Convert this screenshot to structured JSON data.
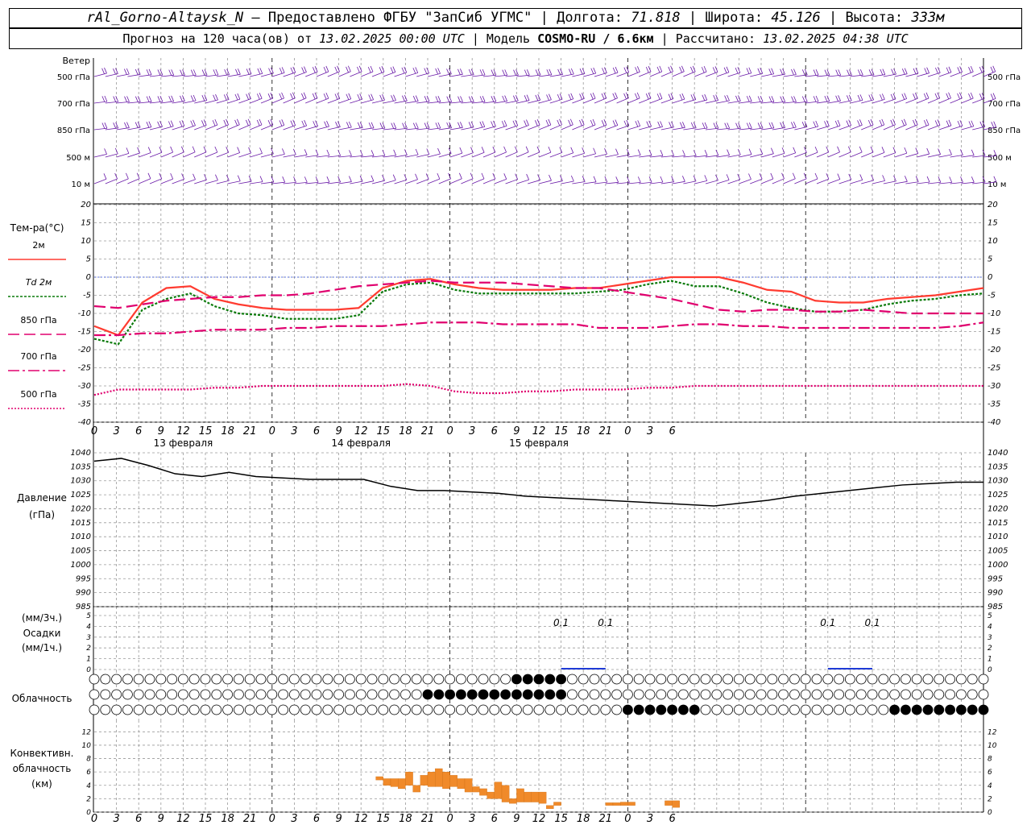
{
  "header": {
    "station": "rAl_Gorno-Altaysk_N",
    "dash": "—",
    "provider": "Предоставлено ФГБУ \"ЗапСиб УГМС\"",
    "lon_label": "Долгота:",
    "lon": "71.818",
    "lat_label": "Широта:",
    "lat": "45.126",
    "alt_label": "Высота:",
    "alt": "333м",
    "sep": "|",
    "forecast_label": "Прогноз на 120 часа(ов) от",
    "forecast_from": "13.02.2025 00:00 UTC",
    "model_label": "Модель",
    "model": "COSMO-RU / 6.6км",
    "calc_label": "Рассчитано:",
    "calc_time": "13.02.2025 04:38 UTC"
  },
  "colors": {
    "t2m": "#ff3b30",
    "td2m": "#0a7a0a",
    "t850": "#e0006e",
    "t700": "#e0006e",
    "t500": "#e0006e",
    "wind": "#6a1aa8",
    "pressure": "#000000",
    "precip": "#1f3bd6",
    "convective": "#f08a2a",
    "grid": "#9a9a9a"
  },
  "x_axis": {
    "ticks": [
      "0",
      "3",
      "6",
      "9",
      "12",
      "15",
      "18",
      "21",
      "0",
      "3",
      "6",
      "9",
      "12",
      "15",
      "18",
      "21",
      "0",
      "3",
      "6",
      "9",
      "12",
      "15",
      "18",
      "21",
      "0",
      "3",
      "6"
    ],
    "date_labels": [
      "13 февраля",
      "14 февраля",
      "15 февраля"
    ]
  },
  "wind_panel": {
    "title": "Ветер",
    "levels": [
      "500 гПа",
      "700 гПа",
      "850 гПа",
      "500 м",
      "10 м"
    ]
  },
  "temp_panel": {
    "title": "Тем-ра(°C)",
    "legend": [
      "2м",
      "Td  2м",
      "850 гПа",
      "700 гПа",
      "500 гПа"
    ],
    "yticks": [
      "20",
      "15",
      "10",
      "5",
      "0",
      "-5",
      "-10",
      "-15",
      "-20",
      "-25",
      "-30",
      "-35",
      "-40"
    ]
  },
  "pressure_panel": {
    "title": "Давление",
    "unit": "(гПа)",
    "yticks": [
      "1040",
      "1035",
      "1030",
      "1025",
      "1020",
      "1015",
      "1010",
      "1005",
      "1000",
      "995",
      "990",
      "985"
    ]
  },
  "precip_panel": {
    "unit3": "(мм/3ч.)",
    "title": "Осадки",
    "unit1": "(мм/1ч.)",
    "yticks": [
      "5",
      "4",
      "3",
      "2",
      "1",
      "0"
    ],
    "labels": [
      {
        "hour": 63,
        "text": "0.1"
      },
      {
        "hour": 69,
        "text": "0.1"
      },
      {
        "hour": 99,
        "text": "0.1"
      },
      {
        "hour": 105,
        "text": "0.1"
      }
    ]
  },
  "cloud_panel": {
    "title": "Облачность"
  },
  "conv_panel": {
    "title1": "Конвективн.",
    "title2": "облачность",
    "unit": "(км)",
    "yticks": [
      "12",
      "10",
      "8",
      "6",
      "4",
      "2",
      "0"
    ]
  },
  "chart_data": [
    {
      "type": "line",
      "title": "Тем-ра(°C)",
      "ylim": [
        -40,
        20
      ],
      "x_hours": [
        0,
        3,
        6,
        9,
        12,
        15,
        18,
        21,
        24,
        27,
        30,
        33,
        36,
        39,
        42,
        45,
        48,
        51,
        54,
        57,
        60,
        63,
        66,
        69,
        72,
        75,
        78,
        81,
        84,
        87,
        90,
        93,
        96,
        99,
        102,
        105,
        108,
        111,
        114,
        117,
        120
      ],
      "series": [
        {
          "name": "2м",
          "values": [
            -13.5,
            -16,
            -7,
            -3,
            -2.5,
            -6,
            -7.5,
            -8.5,
            -9,
            -9,
            -9,
            -8.5,
            -3,
            -1,
            -0.5,
            -2,
            -3,
            -3.5,
            -3.5,
            -3.5,
            -3,
            -3,
            -2,
            -1,
            0,
            0,
            0,
            -1.5,
            -3.5,
            -4,
            -6.5,
            -7,
            -7,
            -6,
            -5.5,
            -5,
            -4,
            -3
          ]
        },
        {
          "name": "Td  2м",
          "values": [
            -17,
            -18.5,
            -9,
            -6,
            -4.5,
            -8,
            -10,
            -10.5,
            -11.5,
            -11.5,
            -11.5,
            -10.5,
            -4,
            -2,
            -1.5,
            -3.5,
            -4.5,
            -4.5,
            -4.5,
            -4.5,
            -4.5,
            -4,
            -3.5,
            -2,
            -1,
            -2.5,
            -2.5,
            -4.5,
            -7,
            -8.5,
            -9.5,
            -9.5,
            -9,
            -7.5,
            -6.5,
            -6,
            -5,
            -4.5
          ]
        },
        {
          "name": "850 гПа",
          "values": [
            -8,
            -8.5,
            -7.5,
            -6.5,
            -6,
            -5.5,
            -5.5,
            -5,
            -5,
            -4.5,
            -3.5,
            -2.5,
            -2,
            -1.5,
            -1,
            -1.5,
            -1.5,
            -1.5,
            -2,
            -2.5,
            -3,
            -3,
            -4,
            -5,
            -6,
            -7.5,
            -9,
            -9.5,
            -9,
            -9,
            -9.5,
            -9.5,
            -9,
            -9.5,
            -10,
            -10,
            -10,
            -10
          ]
        },
        {
          "name": "700 гПа",
          "values": [
            -16,
            -16,
            -15.5,
            -15.5,
            -15,
            -14.5,
            -14.5,
            -14.5,
            -14,
            -14,
            -13.5,
            -13.5,
            -13.5,
            -13,
            -12.5,
            -12.5,
            -12.5,
            -13,
            -13,
            -13,
            -13,
            -14,
            -14,
            -14,
            -13.5,
            -13,
            -13,
            -13.5,
            -13.5,
            -14,
            -14,
            -14,
            -14,
            -14,
            -14,
            -14,
            -13.5,
            -12.5
          ]
        },
        {
          "name": "500 гПа",
          "values": [
            -32.5,
            -31,
            -31,
            -31,
            -31,
            -30.5,
            -30.5,
            -30,
            -30,
            -30,
            -30,
            -30,
            -30,
            -29.5,
            -30,
            -31.5,
            -32,
            -32,
            -31.5,
            -31.5,
            -31,
            -31,
            -31,
            -30.5,
            -30.5,
            -30,
            -30,
            -30,
            -30,
            -30,
            -30,
            -30,
            -30,
            -30,
            -30,
            -30,
            -30,
            -30
          ]
        }
      ]
    },
    {
      "type": "line",
      "title": "Давление",
      "ylabel": "(гПа)",
      "ylim": [
        985,
        1040
      ],
      "x_hours": [
        0,
        3,
        6,
        9,
        12,
        15,
        18,
        21,
        24,
        27,
        30,
        33,
        36,
        39,
        42,
        45,
        48,
        51,
        54,
        57,
        60,
        63,
        66,
        69,
        72,
        75,
        78,
        81,
        84,
        87,
        90,
        93,
        96,
        99,
        102,
        105,
        108,
        111,
        114,
        117,
        120
      ],
      "series": [
        {
          "name": "",
          "values": [
            1037,
            1038,
            1035.5,
            1032.5,
            1031.5,
            1033,
            1031.5,
            1031,
            1030.5,
            1030.5,
            1030.5,
            1028,
            1026.5,
            1026.5,
            1026,
            1025.5,
            1024.5,
            1024,
            1023.5,
            1023,
            1022.5,
            1022,
            1021.5,
            1021,
            1022,
            1023,
            1024.5,
            1025.5,
            1026.5,
            1027.5,
            1028.5,
            1029,
            1029.5,
            1029.5
          ]
        }
      ]
    },
    {
      "type": "bar",
      "title": "Конвективн. облачность",
      "ylabel": "(км)",
      "ylim": [
        0,
        13
      ],
      "bars": [
        {
          "hour": 38,
          "base": 4.8,
          "top": 5.3
        },
        {
          "hour": 39,
          "base": 4.0,
          "top": 5.0
        },
        {
          "hour": 40,
          "base": 3.8,
          "top": 5.0
        },
        {
          "hour": 41,
          "base": 3.5,
          "top": 5.0
        },
        {
          "hour": 42,
          "base": 4.0,
          "top": 6.0
        },
        {
          "hour": 43,
          "base": 3.0,
          "top": 4.0
        },
        {
          "hour": 44,
          "base": 4.0,
          "top": 5.5
        },
        {
          "hour": 45,
          "base": 3.8,
          "top": 6.0
        },
        {
          "hour": 46,
          "base": 3.8,
          "top": 6.5
        },
        {
          "hour": 47,
          "base": 3.5,
          "top": 6.0
        },
        {
          "hour": 48,
          "base": 3.8,
          "top": 5.5
        },
        {
          "hour": 49,
          "base": 3.5,
          "top": 5.0
        },
        {
          "hour": 50,
          "base": 3.0,
          "top": 5.0
        },
        {
          "hour": 51,
          "base": 3.0,
          "top": 3.8
        },
        {
          "hour": 52,
          "base": 2.5,
          "top": 3.5
        },
        {
          "hour": 53,
          "base": 2.0,
          "top": 3.0
        },
        {
          "hour": 54,
          "base": 2.0,
          "top": 4.5
        },
        {
          "hour": 55,
          "base": 1.5,
          "top": 4.0
        },
        {
          "hour": 56,
          "base": 1.3,
          "top": 2.0
        },
        {
          "hour": 57,
          "base": 1.5,
          "top": 3.5
        },
        {
          "hour": 58,
          "base": 1.5,
          "top": 3.0
        },
        {
          "hour": 59,
          "base": 1.5,
          "top": 3.0
        },
        {
          "hour": 60,
          "base": 1.3,
          "top": 3.0
        },
        {
          "hour": 61,
          "base": 0.5,
          "top": 1.0
        },
        {
          "hour": 62,
          "base": 1.0,
          "top": 1.5
        },
        {
          "hour": 69,
          "base": 1.0,
          "top": 1.4
        },
        {
          "hour": 70,
          "base": 1.0,
          "top": 1.4
        },
        {
          "hour": 71,
          "base": 1.0,
          "top": 1.5
        },
        {
          "hour": 72,
          "base": 1.0,
          "top": 1.5
        },
        {
          "hour": 77,
          "base": 1.0,
          "top": 1.7
        },
        {
          "hour": 78,
          "base": 0.7,
          "top": 1.7
        }
      ]
    }
  ]
}
